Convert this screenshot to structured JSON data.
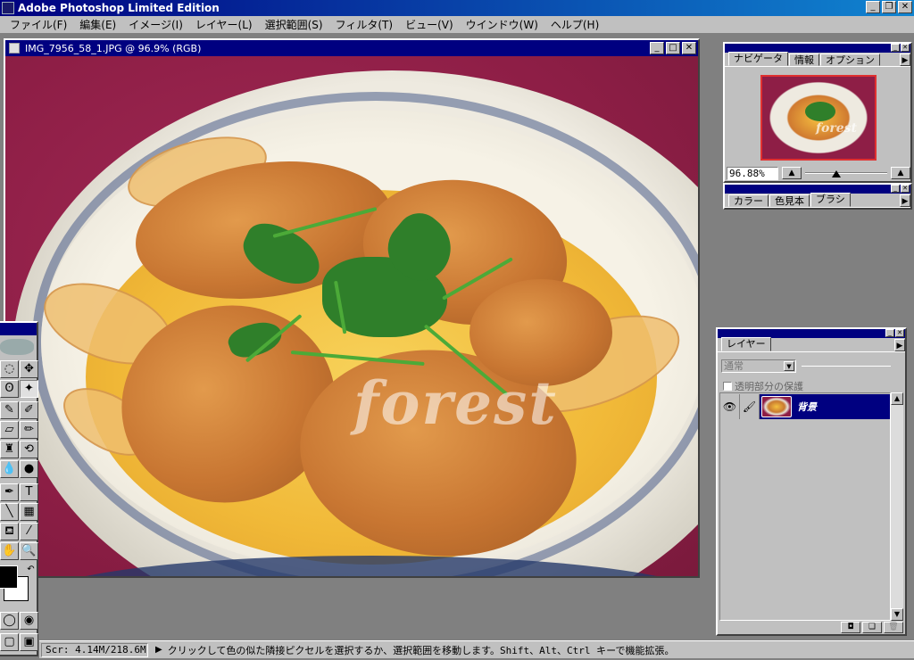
{
  "app": {
    "title": "Adobe Photoshop Limited Edition"
  },
  "menubar": [
    "ファイル(F)",
    "編集(E)",
    "イメージ(I)",
    "レイヤー(L)",
    "選択範囲(S)",
    "フィルタ(T)",
    "ビュー(V)",
    "ウインドウ(W)",
    "ヘルプ(H)"
  ],
  "document": {
    "title": "IMG_7956_58_1.JPG @ 96.9% (RGB)",
    "watermark": "forest"
  },
  "navigator": {
    "tabs": [
      "ナビゲータ",
      "情報",
      "オプション"
    ],
    "zoom_value": "96.88%",
    "thumb_watermark": "forest"
  },
  "colors_palette": {
    "tabs": [
      "カラー",
      "色見本",
      "ブラシ"
    ]
  },
  "layers_palette": {
    "tab": "レイヤー",
    "blend_mode": "通常",
    "preserve_label": "透明部分の保護",
    "layers": [
      {
        "name": "背景"
      }
    ]
  },
  "statusbar": {
    "memory": "Scr: 4.14M/218.6M",
    "hint": "クリックして色の似た隣接ピクセルを選択するか、選択範囲を移動します。Shift、Alt、Ctrl キーで機能拡張。"
  },
  "icons": {
    "minimize": "_",
    "maximize": "□",
    "close": "✕",
    "restore": "❐"
  },
  "colors": {
    "title_bar": "#000080",
    "face": "#c0c0c0",
    "workspace": "#808080",
    "background_cloth": "#8e1e46"
  }
}
